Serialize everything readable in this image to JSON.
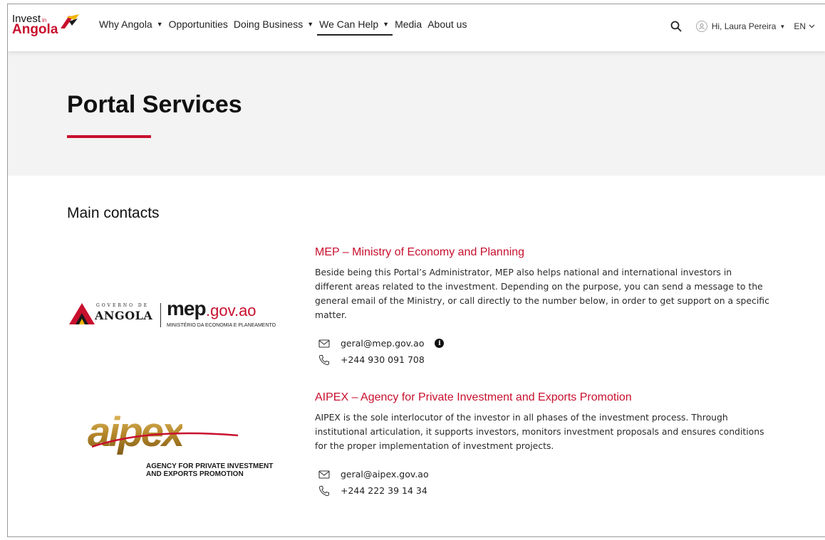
{
  "brand": {
    "line1": "Invest",
    "line1_suffix": "in",
    "line2": "Angola",
    "accent": "#c8102e"
  },
  "nav": {
    "items": [
      {
        "label": "Why Angola",
        "has_menu": true
      },
      {
        "label": "Opportunities",
        "has_menu": false
      },
      {
        "label": "Doing Business",
        "has_menu": true
      },
      {
        "label": "We Can Help",
        "has_menu": true,
        "active": true
      },
      {
        "label": "Media",
        "has_menu": false
      },
      {
        "label": "About us",
        "has_menu": false
      }
    ],
    "user_greeting": "Hi, Laura Pereira",
    "language": "EN"
  },
  "hero": {
    "title": "Portal Services"
  },
  "main": {
    "section_title": "Main contacts",
    "contacts": [
      {
        "logo_text": {
          "gov_line": "GOVERNO DE",
          "country": "ANGOLA",
          "brand": "mep",
          "domain": ".gov.ao",
          "ministry": "MINISTÉRIO DA ECONOMIA E PLANEAMENTO"
        },
        "title": "MEP – Ministry of Economy and Planning",
        "description": "Beside being this Portal’s Administrator, MEP also helps national and international investors in different areas related to the investment. Depending on the purpose, you can send a message to the general email of the Ministry, or call directly to the number below, in order to get support on a specific matter.",
        "email": "geral@mep.gov.ao",
        "phone": "+244 930 091 708"
      },
      {
        "logo_text": {
          "brand": "aipex",
          "tagline_1": "AGENCY FOR PRIVATE INVESTMENT",
          "tagline_2": "AND EXPORTS PROMOTION"
        },
        "title": "AIPEX – Agency for Private Investment and Exports Promotion",
        "description": "AIPEX is the sole interlocutor of the investor in all phases of the investment process. Through institutional articulation, it supports investors, monitors investment proposals and ensures conditions for the proper implementation of investment projects.",
        "email": "geral@aipex.gov.ao",
        "phone": "+244 222 39 14 34"
      }
    ]
  },
  "icons": {
    "search": "search-icon",
    "user": "user-icon",
    "chevron": "chevron-down-icon",
    "email": "mail-icon",
    "phone": "phone-icon",
    "info": "info-icon"
  }
}
